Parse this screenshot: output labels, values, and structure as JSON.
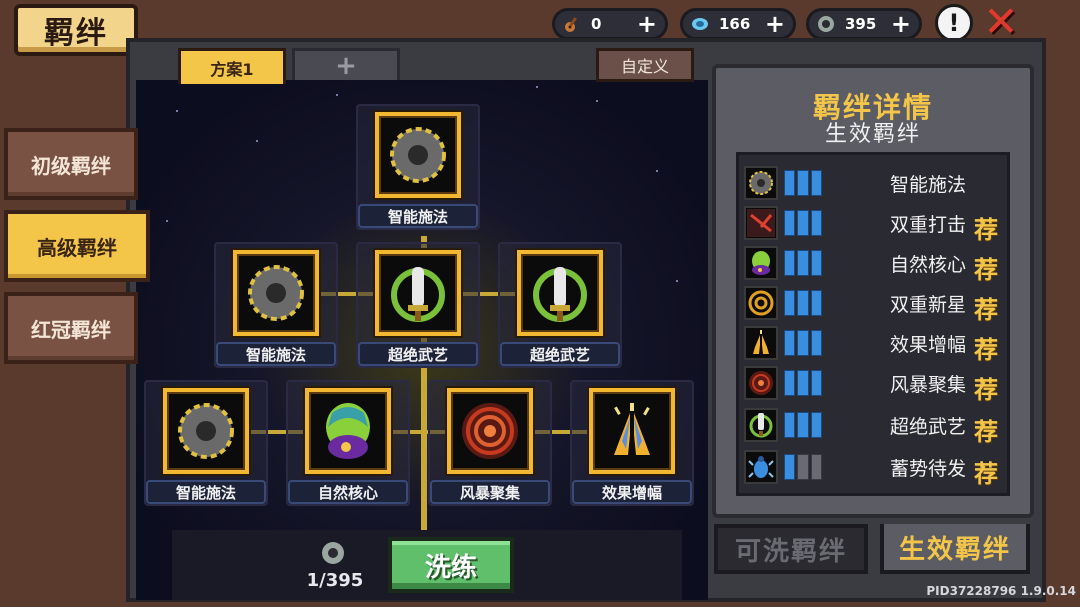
{
  "header": {
    "title": "羁绊",
    "currencies": [
      {
        "icon": "violin-icon",
        "value": "0"
      },
      {
        "icon": "blue-gem-icon",
        "value": "166"
      },
      {
        "icon": "ring-token-icon",
        "value": "395"
      }
    ],
    "plus_label": "+",
    "info_label": "!",
    "close_label": "✕"
  },
  "tabs": {
    "scheme": "方案1",
    "add": "+",
    "custom": "自定义"
  },
  "sidebar": {
    "items": [
      {
        "label": "初级羁绊",
        "active": false
      },
      {
        "label": "高级羁绊",
        "active": true
      },
      {
        "label": "红冠羁绊",
        "active": false
      }
    ]
  },
  "tree": {
    "nodes": [
      {
        "label": "智能施法",
        "icon": "gear-icon"
      },
      {
        "label": "智能施法",
        "icon": "gear-icon"
      },
      {
        "label": "超绝武艺",
        "icon": "sword-icon"
      },
      {
        "label": "超绝武艺",
        "icon": "sword-icon"
      },
      {
        "label": "智能施法",
        "icon": "gear-icon"
      },
      {
        "label": "自然核心",
        "icon": "nature-core-icon"
      },
      {
        "label": "风暴聚集",
        "icon": "storm-ring-icon"
      },
      {
        "label": "效果增幅",
        "icon": "praying-hands-icon"
      }
    ]
  },
  "action": {
    "cost": "1/395",
    "refine_label": "洗练"
  },
  "panel": {
    "title": "羁绊详情",
    "subtitle": "生效羁绊",
    "rows": [
      {
        "name": "智能施法",
        "icon": "gear-icon",
        "bars": 3,
        "recommended": false
      },
      {
        "name": "双重打击",
        "icon": "double-slash-icon",
        "bars": 3,
        "recommended": true
      },
      {
        "name": "自然核心",
        "icon": "nature-core-icon",
        "bars": 3,
        "recommended": true
      },
      {
        "name": "双重新星",
        "icon": "nova-rings-icon",
        "bars": 3,
        "recommended": true
      },
      {
        "name": "效果增幅",
        "icon": "praying-hands-icon",
        "bars": 3,
        "recommended": true
      },
      {
        "name": "风暴聚集",
        "icon": "storm-ring-icon",
        "bars": 3,
        "recommended": true
      },
      {
        "name": "超绝武艺",
        "icon": "sword-icon",
        "bars": 3,
        "recommended": true
      },
      {
        "name": "蓄势待发",
        "icon": "beetle-icon",
        "bars": 1,
        "recommended": true
      }
    ],
    "recommend_label": "荐",
    "tabs": [
      {
        "label": "可洗羁绊",
        "active": false
      },
      {
        "label": "生效羁绊",
        "active": true
      }
    ]
  },
  "footer": {
    "pid": "PID37228796 1.9.0.14"
  },
  "colors": {
    "accent": "#f3c64a",
    "frame": "#3b3b42",
    "wood": "#5a3a2c",
    "refine_green": "#5fbf6a",
    "bar_blue": "#3a8ee0"
  }
}
